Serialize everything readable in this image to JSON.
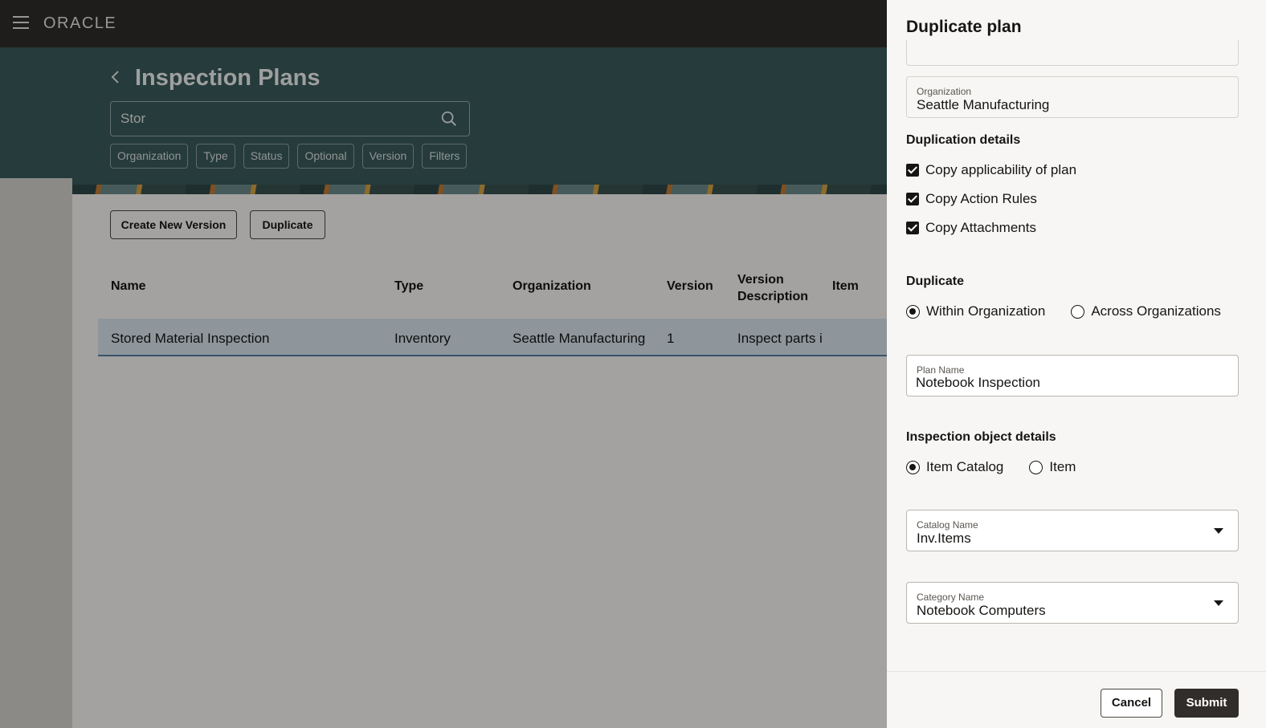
{
  "app": {
    "brand": "ORACLE"
  },
  "page": {
    "title": "Inspection Plans",
    "search_value": "Stor",
    "filter_chips": [
      "Organization",
      "Type",
      "Status",
      "Optional",
      "Version",
      "Filters"
    ]
  },
  "toolbar": {
    "create_label": "Create New Version",
    "duplicate_label": "Duplicate"
  },
  "table": {
    "headers": {
      "name": "Name",
      "type": "Type",
      "organization": "Organization",
      "version": "Version",
      "version_desc_1": "Version",
      "version_desc_2": "Description",
      "item": "Item"
    },
    "rows": [
      {
        "name": "Stored Material Inspection",
        "type": "Inventory",
        "organization": "Seattle Manufacturing",
        "version": "1",
        "version_description": "Inspect parts i"
      }
    ]
  },
  "drawer": {
    "title": "Duplicate plan",
    "organization": {
      "label": "Organization",
      "value": "Seattle Manufacturing"
    },
    "duplication_details": {
      "heading": "Duplication details",
      "options": [
        {
          "label": "Copy applicability of plan",
          "checked": true
        },
        {
          "label": "Copy Action Rules",
          "checked": true
        },
        {
          "label": "Copy Attachments",
          "checked": true
        }
      ]
    },
    "duplicate": {
      "heading": "Duplicate",
      "options": [
        "Within Organization",
        "Across Organizations"
      ],
      "selected": "Within Organization"
    },
    "plan_name": {
      "label": "Plan Name",
      "value": "Notebook Inspection"
    },
    "inspection_object": {
      "heading": "Inspection object details",
      "options": [
        "Item Catalog",
        "Item"
      ],
      "selected": "Item Catalog"
    },
    "catalog_name": {
      "label": "Catalog Name",
      "value": "Inv.Items"
    },
    "category_name": {
      "label": "Category Name",
      "value": "Notebook Computers"
    },
    "cancel_label": "Cancel",
    "submit_label": "Submit"
  }
}
